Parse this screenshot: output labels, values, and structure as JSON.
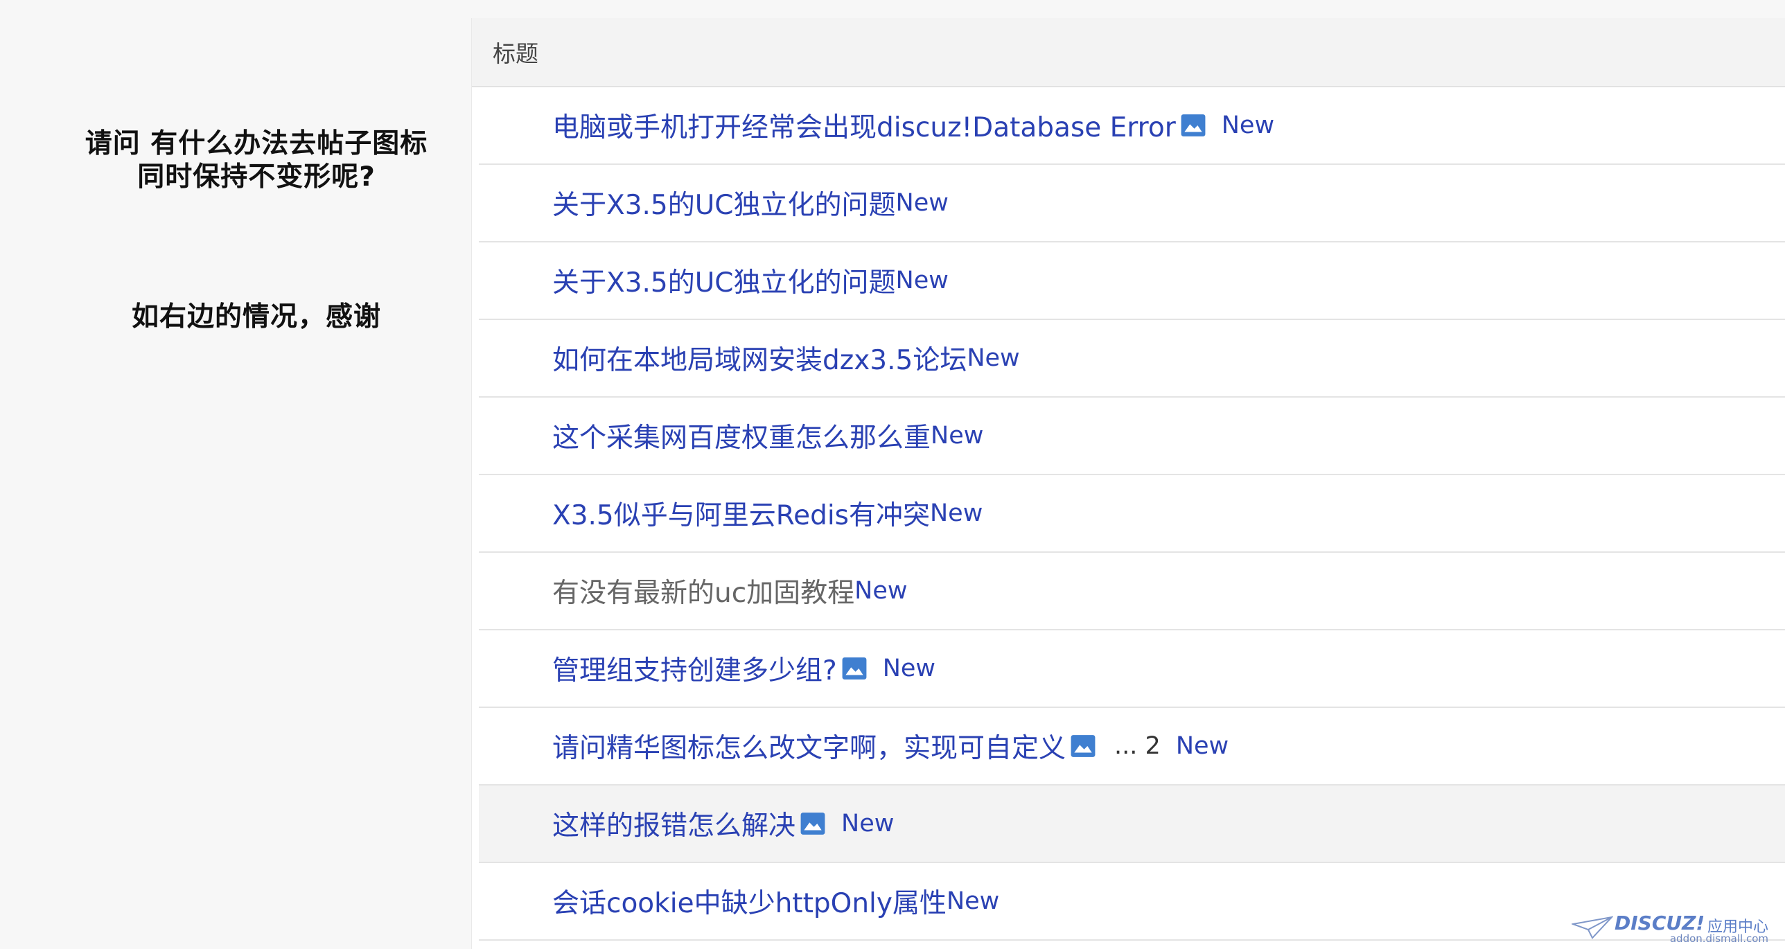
{
  "note": {
    "line1": "请问 有什么办法去帖子图标",
    "line2": "同时保持不变形呢?",
    "line3": "如右边的情况，感谢"
  },
  "table": {
    "header": "标题",
    "rows": [
      {
        "title": "电脑或手机打开经常会出现discuz!Database Error",
        "has_image": true,
        "visited": false,
        "new": "New"
      },
      {
        "title": "关于X3.5的UC独立化的问题",
        "has_image": false,
        "visited": false,
        "new": "New"
      },
      {
        "title": "关于X3.5的UC独立化的问题",
        "has_image": false,
        "visited": false,
        "new": "New"
      },
      {
        "title": "如何在本地局域网安装dzx3.5论坛",
        "has_image": false,
        "visited": false,
        "new": "New"
      },
      {
        "title": "这个采集网百度权重怎么那么重",
        "has_image": false,
        "visited": false,
        "new": "New"
      },
      {
        "title": "X3.5似乎与阿里云Redis有冲突",
        "has_image": false,
        "visited": false,
        "new": "New"
      },
      {
        "title": "有没有最新的uc加固教程",
        "has_image": false,
        "visited": true,
        "new": "New"
      },
      {
        "title": "管理组支持创建多少组?",
        "has_image": true,
        "visited": false,
        "new": "New"
      },
      {
        "title": "请问精华图标怎么改文字啊，实现可自定义",
        "has_image": true,
        "visited": false,
        "new": "New",
        "pages_ellipsis": "...",
        "pages_last": "2"
      },
      {
        "title": "这样的报错怎么解决",
        "has_image": true,
        "visited": false,
        "new": "New",
        "hover": true
      },
      {
        "title": "会话cookie中缺少httpOnly属性",
        "has_image": false,
        "visited": false,
        "new": "New"
      }
    ]
  },
  "icons": {
    "image_attachment": "image-icon"
  },
  "colors": {
    "link": "#2a41b3",
    "visited": "#666666",
    "icon": "#3f7fd0"
  },
  "watermark": {
    "logo": "DISCUZ!",
    "name": "应用中心",
    "url": "addon.dismall.com"
  }
}
